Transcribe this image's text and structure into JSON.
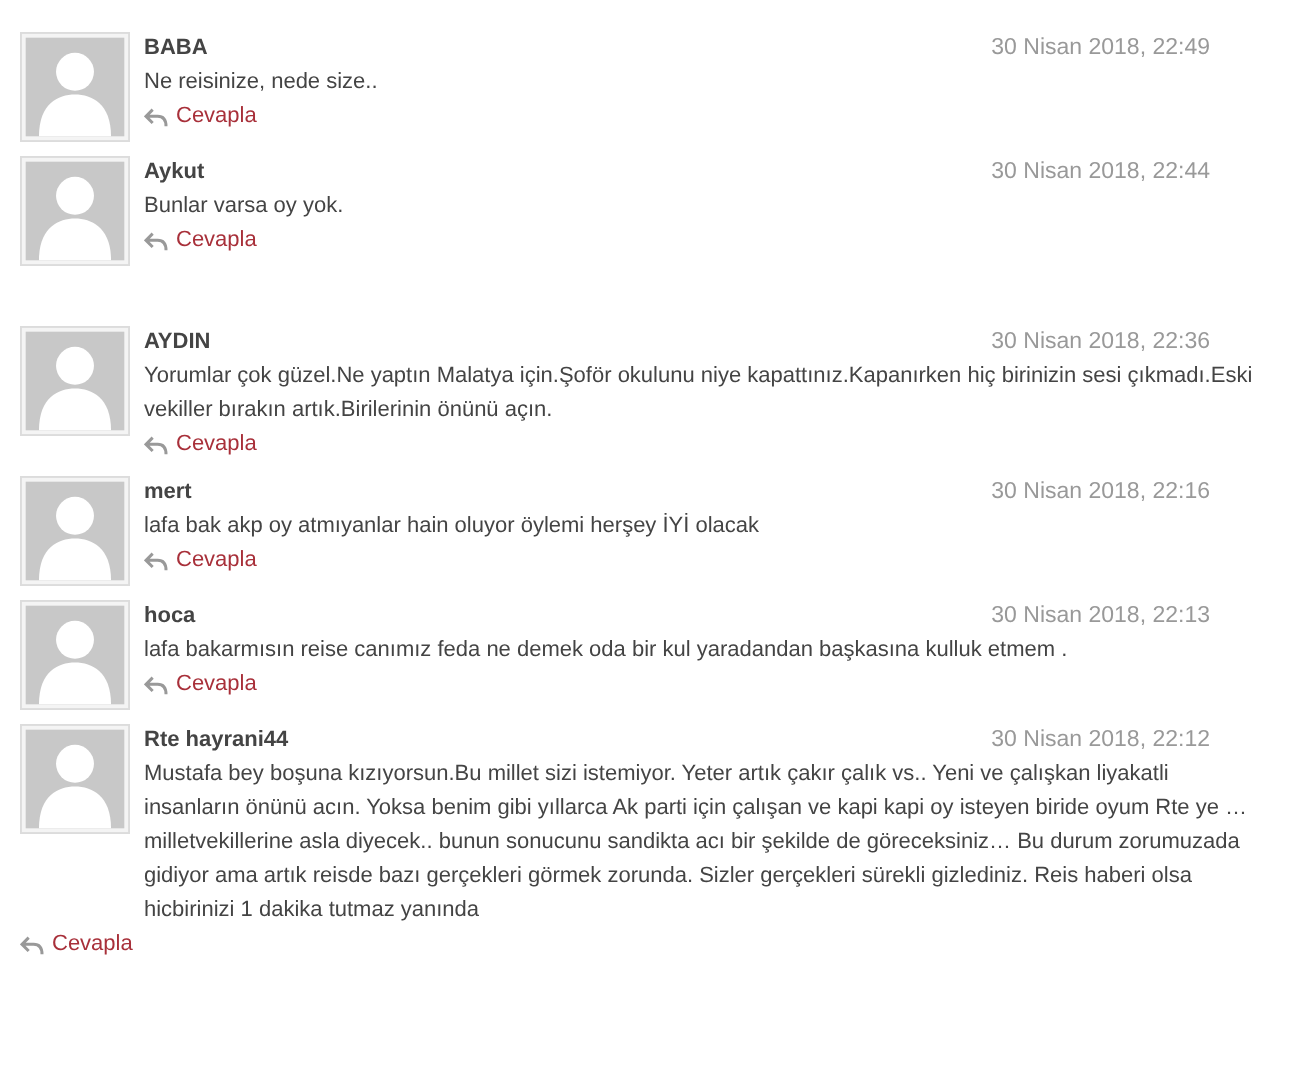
{
  "threads": [
    {
      "comments": [
        {
          "author": "BABA",
          "date": "30 Nisan 2018, 22:49",
          "text": "Ne reisinize, nede size..",
          "reply": "Cevapla"
        },
        {
          "author": "Aykut",
          "date": "30 Nisan 2018, 22:44",
          "text": "Bunlar varsa oy yok.",
          "reply": "Cevapla"
        }
      ]
    },
    {
      "comments": [
        {
          "author": "AYDIN",
          "date": "30 Nisan 2018, 22:36",
          "text": "Yorumlar çok güzel.Ne yaptın Malatya için.Şoför okulunu niye kapattınız.Kapanırken hiç birinizin sesi çıkmadı.Eski vekiller bırakın artık.Birilerinin önünü açın.",
          "reply": "Cevapla"
        },
        {
          "author": "mert",
          "date": "30 Nisan 2018, 22:16",
          "text": "lafa bak akp oy atmıyanlar hain oluyor öylemi herşey İYİ olacak",
          "reply": "Cevapla"
        },
        {
          "author": "hoca",
          "date": "30 Nisan 2018, 22:13",
          "text": "lafa bakarmısın reise canımız feda ne demek oda bir kul yaradandan başkasına kulluk etmem .",
          "reply": "Cevapla"
        },
        {
          "author": "Rte hayrani44",
          "date": "30 Nisan 2018, 22:12",
          "text": "Mustafa bey boşuna kızıyorsun.Bu millet sizi istemiyor. Yeter artık çakır çalık vs.. Yeni ve çalışkan liyakatli insanların önünü acın. Yoksa benim gibi yıllarca Ak parti için çalışan ve kapi kapi oy isteyen biride oyum Rte ye …milletvekillerine asla diyecek.. bunun sonucunu sandikta acı bir şekilde de göreceksiniz… Bu durum zorumuzada gidiyor ama artık reisde bazı gerçekleri görmek zorunda. Sizler gerçekleri sürekli gizlediniz. Reis haberi olsa hicbirinizi 1 dakika tutmaz yanında",
          "reply": "Cevapla"
        }
      ]
    }
  ]
}
